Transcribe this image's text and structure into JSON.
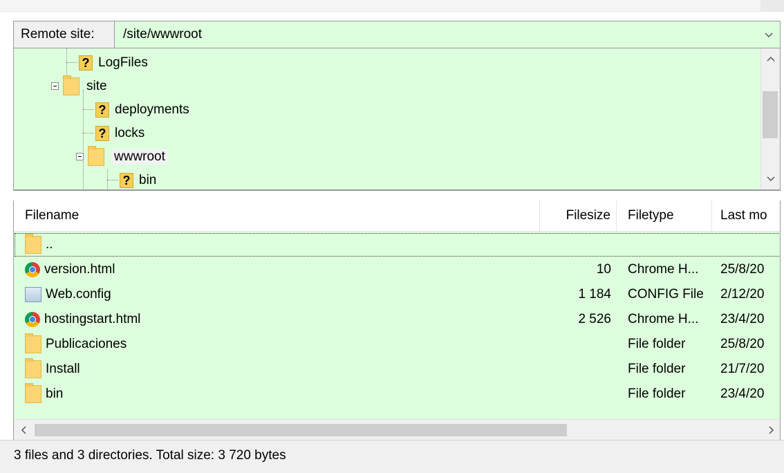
{
  "remote_site": {
    "label": "Remote site:",
    "path": "/site/wwwroot",
    "dropdown_glyph": "⌵"
  },
  "tree": {
    "items": [
      {
        "name": "LogFiles",
        "icon": "question-folder-icon"
      },
      {
        "name": "site",
        "icon": "folder-icon",
        "expanded": true
      },
      {
        "name": "deployments",
        "icon": "question-folder-icon"
      },
      {
        "name": "locks",
        "icon": "question-folder-icon"
      },
      {
        "name": "wwwroot",
        "icon": "folder-icon",
        "expanded": true,
        "selected": true
      },
      {
        "name": "bin",
        "icon": "question-folder-icon"
      }
    ],
    "question_mark": "?",
    "scroll_up": "^",
    "scroll_down": "⌵"
  },
  "file_list": {
    "columns": [
      "Filename",
      "Filesize",
      "Filetype",
      "Last mo"
    ],
    "rows": [
      {
        "name": "..",
        "size": "",
        "type": "",
        "modified": "",
        "icon": "folder-icon"
      },
      {
        "name": "version.html",
        "size": "10",
        "type": "Chrome H...",
        "modified": "25/8/20",
        "icon": "chrome-icon"
      },
      {
        "name": "Web.config",
        "size": "1 184",
        "type": "CONFIG File",
        "modified": "2/12/20",
        "icon": "config-file-icon"
      },
      {
        "name": "hostingstart.html",
        "size": "2 526",
        "type": "Chrome H...",
        "modified": "23/4/20",
        "icon": "chrome-icon"
      },
      {
        "name": "Publicaciones",
        "size": "",
        "type": "File folder",
        "modified": "25/8/20",
        "icon": "folder-icon"
      },
      {
        "name": "Install",
        "size": "",
        "type": "File folder",
        "modified": "21/7/20",
        "icon": "folder-icon"
      },
      {
        "name": "bin",
        "size": "",
        "type": "File folder",
        "modified": "23/4/20",
        "icon": "folder-icon"
      }
    ],
    "scroll_left": "<",
    "scroll_right": ">"
  },
  "status": {
    "text": "3 files and 3 directories. Total size: 3 720 bytes"
  },
  "colors": {
    "panel_bg": "#ddffdd",
    "folder": "#fbd672",
    "border": "#9a9a9a"
  }
}
